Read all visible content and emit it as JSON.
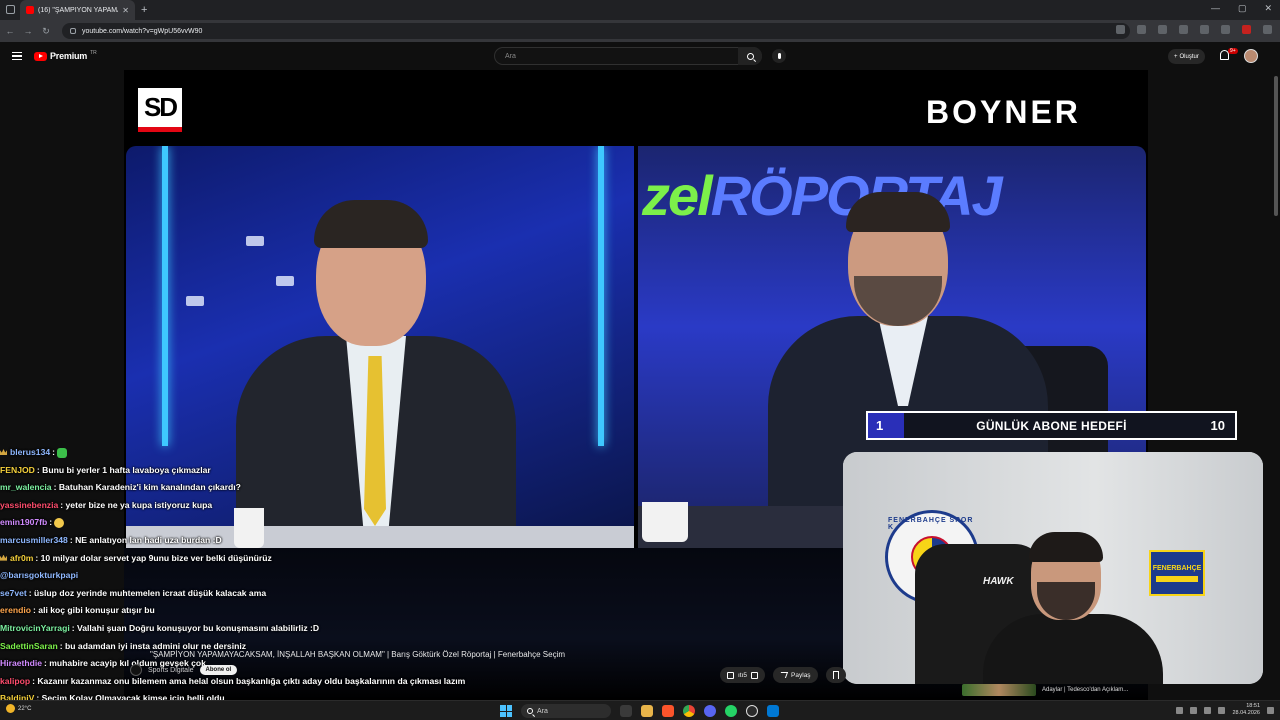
{
  "browser": {
    "tab_title": "(16) \"ŞAMPİYON YAPAMAY...",
    "url": "youtube.com/watch?v=gWpU56vvW90"
  },
  "youtube": {
    "logo_text": "Premium",
    "logo_badge": "TR",
    "search_placeholder": "Ara",
    "create_label": "Oluştur",
    "notification_count": "9+"
  },
  "video": {
    "sd_logo": "SD",
    "sponsor": "BOYNER",
    "studio_text_green": "zel",
    "studio_text_blue": "RÖPORTAJ",
    "title": "\"ŞAMPİYON YAPAMAYACAKSAM, İNŞALLAH BAŞKAN OLMAM\" | Barış Göktürk Özel Röportaj | Fenerbahçe Seçim",
    "channel": "Sports Digitale",
    "subscribe_label": "Abone ol",
    "like_count": "ıtı5",
    "share_label": "Paylaş"
  },
  "goal": {
    "start": "1",
    "title": "GÜNLÜK ABONE HEDEFİ",
    "end": "10"
  },
  "webcam": {
    "crest_text": "FENERBAHÇE SPOR K",
    "crest_year": "1907",
    "flag_text": "FENERBAHÇE",
    "chair_brand": "HAWK"
  },
  "chat": [
    {
      "name": "blerus134",
      "color": "#8fb8ff",
      "msg": ":",
      "crown": true,
      "emote": "green"
    },
    {
      "name": "FENJOD",
      "color": "#f5d13b",
      "msg": ": Bunu bi yerler 1 hafta lavaboya çıkmazlar"
    },
    {
      "name": "mr_walencia",
      "color": "#7cf0a0",
      "msg": ": Batuhan Karadeniz'i kim kanalından çıkardı?"
    },
    {
      "name": "yassinebenzia",
      "color": "#ff4d6d",
      "msg": ": yeter bize ne ya kupa istiyoruz kupa"
    },
    {
      "name": "emin1907fb",
      "color": "#d18bff",
      "msg": ":",
      "emote": "yellow"
    },
    {
      "name": "marcusmiller348",
      "color": "#8fb8ff",
      "msg": ": NE anlatıyon lan hadi uza burdan :D"
    },
    {
      "name": "afr0m",
      "color": "#f5d13b",
      "msg": ": 10 milyar dolar servet yap 9unu bize ver belki düşünürüz",
      "crown": true
    },
    {
      "name": "@barısgokturkpapi",
      "color": "#8fb8ff",
      "msg": ""
    },
    {
      "name": "se7vet",
      "color": "#8fb8ff",
      "msg": ": üslup doz yerinde muhtemelen icraat düşük kalacak ama"
    },
    {
      "name": "erendio",
      "color": "#ffa64d",
      "msg": ": ali koç gibi konuşur atışır bu"
    },
    {
      "name": "MitrovicinYarragi",
      "color": "#7cf0a0",
      "msg": ": Vallahi şuan Doğru konuşuyor bu konuşmasını alabilirliz :D"
    },
    {
      "name": "SadettinSaran",
      "color": "#7cf04a",
      "msg": ": bu adamdan iyi insta admini olur ne dersiniz"
    },
    {
      "name": "Hiraethdie",
      "color": "#d18bff",
      "msg": ": muhabire acayip kıl oldum gevşek çok"
    },
    {
      "name": "kalipop",
      "color": "#ff4d6d",
      "msg": ": Kazanır kazanmaz onu bilemem ama helal olsun başkanlığa çıktı aday oldu başkalarının da çıkması lazım"
    },
    {
      "name": "BaldiniV",
      "color": "#f5d13b",
      "msg": ": Seçim Kolay Olmayacak kimse için belli oldu"
    }
  ],
  "related": {
    "title": "Adaylar | Tedesco'dan Açıklam..."
  },
  "taskbar": {
    "weather": "22°C",
    "search_label": "Ara",
    "time": "18:51",
    "date": "28.04.2026"
  }
}
